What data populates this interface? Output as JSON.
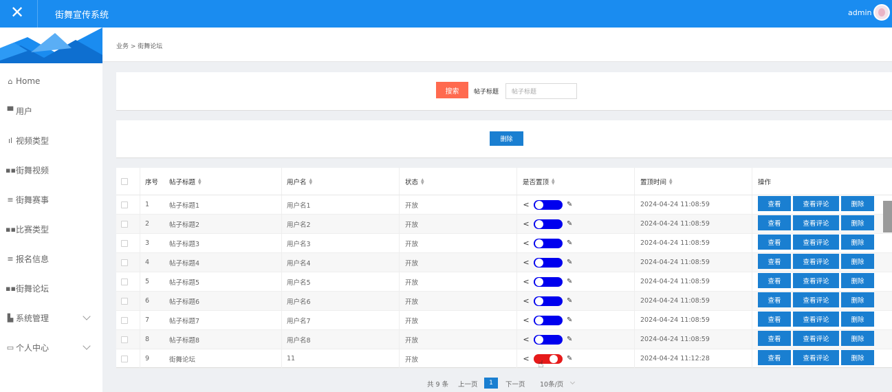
{
  "header": {
    "close_glyph": "✕",
    "app_title": "街舞宣传系统",
    "user": "admin"
  },
  "sidebar": {
    "items": [
      {
        "icon": "⌂",
        "label": "Home",
        "expandable": false
      },
      {
        "icon": "▀",
        "label": "用户",
        "expandable": false
      },
      {
        "icon": "ıl",
        "label": "视频类型",
        "expandable": false
      },
      {
        "icon": "▪▪",
        "label": "街舞视频",
        "expandable": false
      },
      {
        "icon": "≡",
        "label": "街舞赛事",
        "expandable": false
      },
      {
        "icon": "▪▪",
        "label": "比赛类型",
        "expandable": false
      },
      {
        "icon": "≡",
        "label": "报名信息",
        "expandable": false
      },
      {
        "icon": "▪▪",
        "label": "街舞论坛",
        "expandable": false
      },
      {
        "icon": "▙",
        "label": "系统管理",
        "expandable": true
      },
      {
        "icon": "▭",
        "label": "个人中心",
        "expandable": true
      }
    ]
  },
  "breadcrumb": "业务 > 街舞论坛",
  "search": {
    "button_label": "搜索",
    "field_label": "帖子标题",
    "placeholder": "帖子标题"
  },
  "actions": {
    "delete_label": "删除"
  },
  "table": {
    "columns": [
      "序号",
      "帖子标题",
      "用户名",
      "状态",
      "是否置顶",
      "置顶时间",
      "操作"
    ],
    "rows": [
      {
        "index": "1",
        "title": "帖子标题1",
        "user": "用户名1",
        "status": "开放",
        "pinned": true,
        "time": "2024-04-24 11:08:59"
      },
      {
        "index": "2",
        "title": "帖子标题2",
        "user": "用户名2",
        "status": "开放",
        "pinned": true,
        "time": "2024-04-24 11:08:59"
      },
      {
        "index": "3",
        "title": "帖子标题3",
        "user": "用户名3",
        "status": "开放",
        "pinned": true,
        "time": "2024-04-24 11:08:59"
      },
      {
        "index": "4",
        "title": "帖子标题4",
        "user": "用户名4",
        "status": "开放",
        "pinned": true,
        "time": "2024-04-24 11:08:59"
      },
      {
        "index": "5",
        "title": "帖子标题5",
        "user": "用户名5",
        "status": "开放",
        "pinned": true,
        "time": "2024-04-24 11:08:59"
      },
      {
        "index": "6",
        "title": "帖子标题6",
        "user": "用户名6",
        "status": "开放",
        "pinned": true,
        "time": "2024-04-24 11:08:59"
      },
      {
        "index": "7",
        "title": "帖子标题7",
        "user": "用户名7",
        "status": "开放",
        "pinned": true,
        "time": "2024-04-24 11:08:59"
      },
      {
        "index": "8",
        "title": "帖子标题8",
        "user": "用户名8",
        "status": "开放",
        "pinned": true,
        "time": "2024-04-24 11:08:59"
      },
      {
        "index": "9",
        "title": "街舞论坛",
        "user": "11",
        "status": "开放",
        "pinned": false,
        "time": "2024-04-24 11:12:28"
      }
    ],
    "row_actions": {
      "view": "查看",
      "view_comments": "查看评论",
      "delete": "删除"
    }
  },
  "pagination": {
    "total": "共 9 条",
    "prev": "上一页",
    "current": "1",
    "next": "下一页",
    "page_size": "10条/页"
  },
  "colors": {
    "header_blue": "#1a8cf0",
    "button_blue": "#1a7fd1",
    "search_orange": "#ff6a4f",
    "toggle_on": "#0000ee",
    "toggle_off": "#e61a1a"
  }
}
